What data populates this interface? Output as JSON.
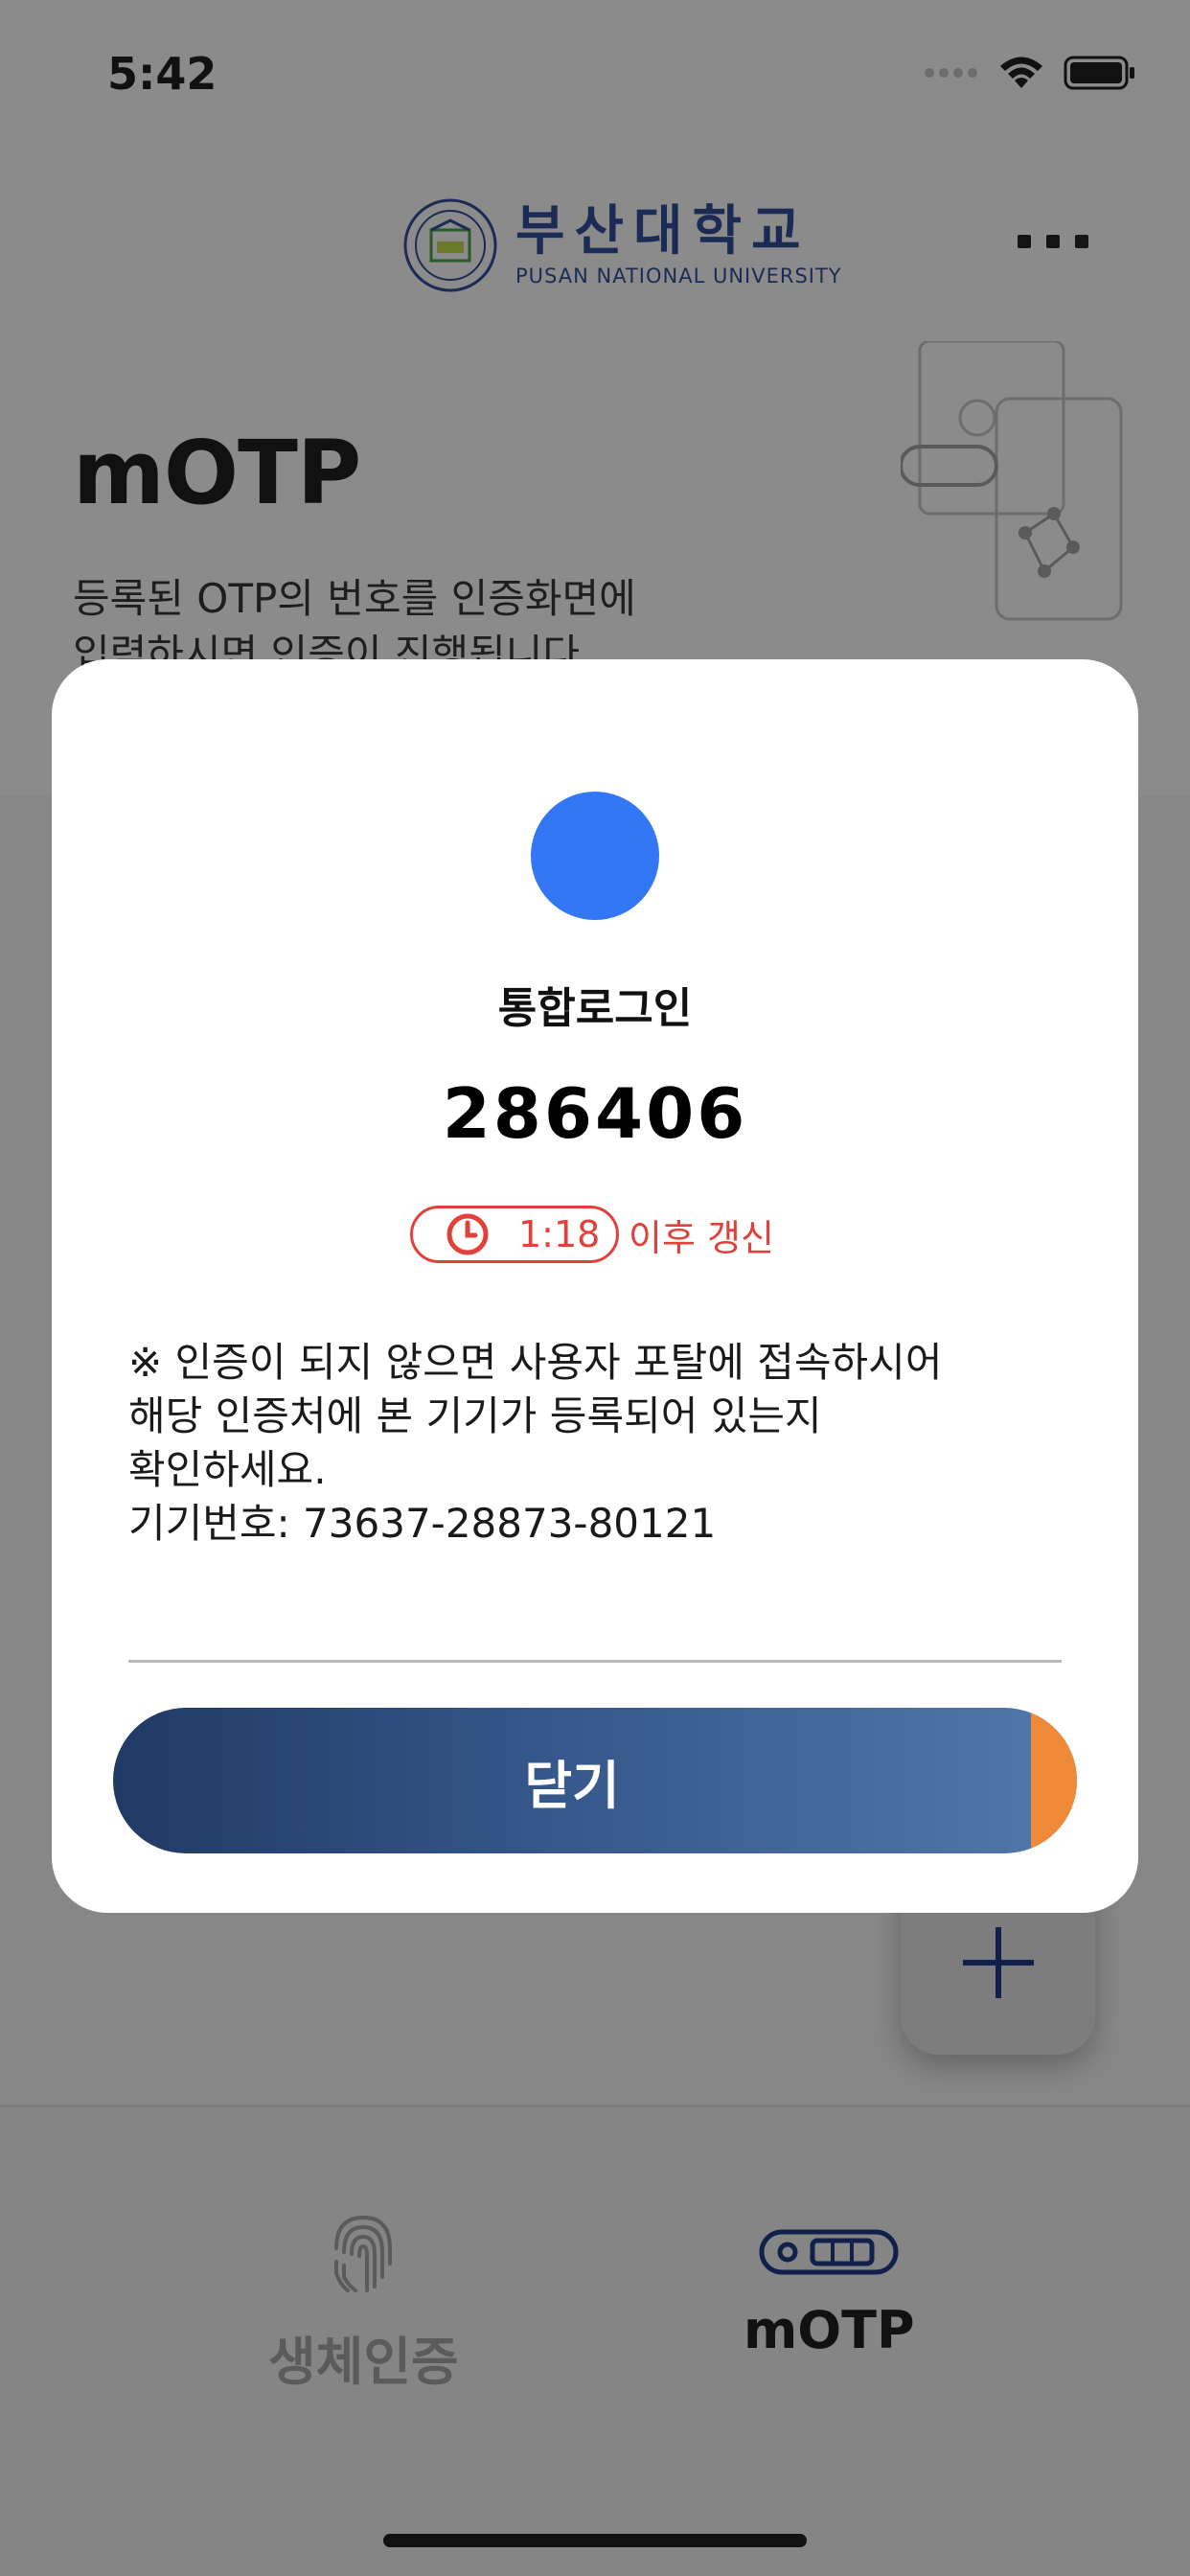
{
  "status_bar": {
    "time": "5:42"
  },
  "header": {
    "logo_korean": "부산대학교",
    "logo_english": "PUSAN NATIONAL UNIVERSITY",
    "menu_icon": "more-icon"
  },
  "page": {
    "title": "mOTP",
    "description_line1": "등록된 OTP의 번호를 인증화면에",
    "description_line2": "입력하시면 인증이 진행됩니다."
  },
  "fab": {
    "icon": "plus-icon"
  },
  "tabbar": {
    "tabs": [
      {
        "label": "생체인증",
        "icon": "fingerprint-icon",
        "active": false
      },
      {
        "label": "mOTP",
        "icon": "otp-token-icon",
        "active": true
      }
    ]
  },
  "modal": {
    "title": "통합로그인",
    "code": "286406",
    "timer": {
      "remaining": "1:18",
      "suffix": "이후 갱신",
      "icon": "clock-icon"
    },
    "notice": {
      "line1": "※  인증이 되지 않으면 사용자 포탈에 접속하시어",
      "line2": "해당 인증처에 본 기기가 등록되어 있는지",
      "line3": "확인하세요.",
      "line4": "기기번호: 73637-28873-80121"
    },
    "close_label": "닫기"
  },
  "colors": {
    "avatar": "#3477f5",
    "timer": "#e0413a",
    "button_start": "#203a64",
    "button_end": "#5279aa",
    "button_accent": "#ee8a38",
    "brand_navy": "#1c2b55"
  }
}
